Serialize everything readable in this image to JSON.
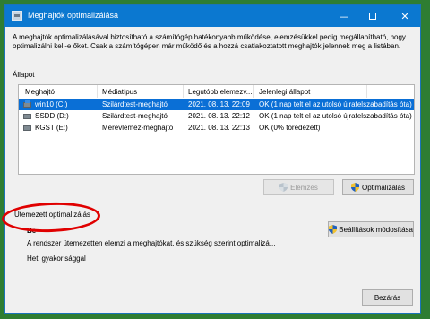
{
  "window": {
    "title": "Meghajtók optimalizálása",
    "minimize_glyph": "—",
    "close_glyph": "✕"
  },
  "description": "A meghajtók optimalizálásával biztosítható a számítógép hatékonyabb működése, elemzésükkel pedig megállapítható, hogy optimalizálni kell-e őket. Csak a számítógépen már működő és a hozzá csatlakoztatott meghajtók jelennek meg a listában.",
  "status_label": "Állapot",
  "table": {
    "columns": [
      "Meghajtó",
      "Médiatípus",
      "Legutóbb elemezv...",
      "Jelenlegi állapot"
    ],
    "rows": [
      {
        "drive": "win10 (C:)",
        "media": "Szilárdtest-meghajtó",
        "last": "2021. 08. 13. 22:09",
        "state": "OK (1 nap telt el az utolsó újrafelszabadítás óta)",
        "icon": "windows-drive-icon",
        "selected": true
      },
      {
        "drive": "SSDD (D:)",
        "media": "Szilárdtest-meghajtó",
        "last": "2021. 08. 13. 22:12",
        "state": "OK (1 nap telt el az utolsó újrafelszabadítás óta)",
        "icon": "drive-icon",
        "selected": false
      },
      {
        "drive": "KGST (E:)",
        "media": "Merevlemez-meghajtó",
        "last": "2021. 08. 13. 22:13",
        "state": "OK (0% töredezett)",
        "icon": "drive-icon",
        "selected": false
      }
    ]
  },
  "buttons": {
    "analyze": "Elemzés",
    "optimize": "Optimalizálás",
    "change_settings": "Beállítások módosítása",
    "close": "Bezárás"
  },
  "scheduled": {
    "heading": "Ütemezett optimalizálás",
    "state": "Be",
    "description": "A rendszer ütemezetten elemzi a meghajtókat, és szükség szerint optimalizá...",
    "frequency": "Heti gyakorisággal"
  },
  "colors": {
    "titlebar": "#0b78d0",
    "selection": "#0a6fd6",
    "annotation": "#e00000",
    "background": "#2e7d32"
  }
}
